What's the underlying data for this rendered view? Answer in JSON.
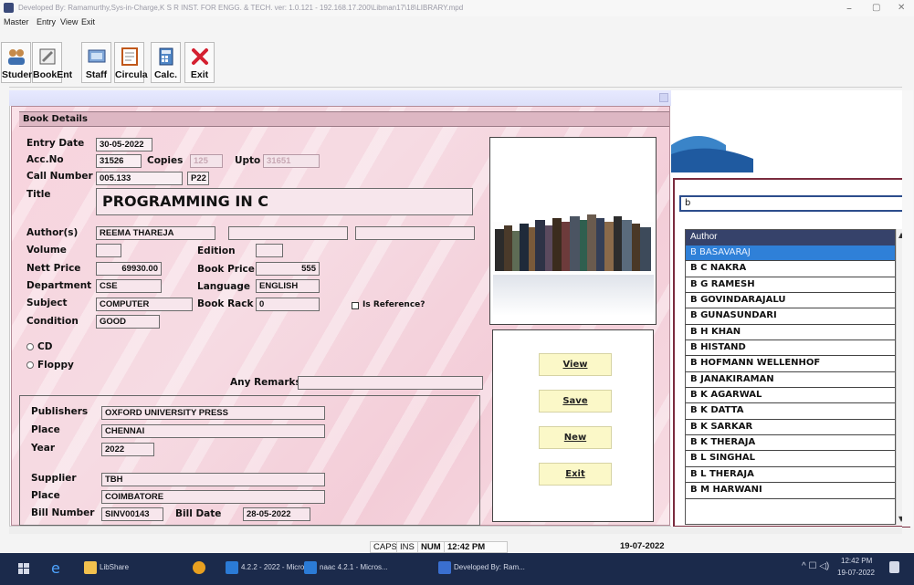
{
  "window": {
    "title": "Developed By: Ramamurthy,Sys-in-Charge,K S R INST. FOR ENGG. & TECH. ver: 1.0.121 - 192.168.17.200\\Libman17\\18\\LIBRARY.mpd",
    "minimize": "–",
    "restore": "▢",
    "close": "✕"
  },
  "menu": [
    "Master",
    "Entry",
    "View",
    "Exit"
  ],
  "toolbar": [
    {
      "label": "Student",
      "icon": "students-icon"
    },
    {
      "label": "BookEnt",
      "icon": "book-entry-icon"
    },
    {
      "label": "Staff",
      "icon": "staff-icon"
    },
    {
      "label": "Circula",
      "icon": "circulation-icon"
    },
    {
      "label": "Calc.",
      "icon": "calculator-icon"
    },
    {
      "label": "Exit",
      "icon": "exit-icon"
    }
  ],
  "form": {
    "header": "Book Details",
    "labels": {
      "entry_date": "Entry Date",
      "acc_no": "Acc.No",
      "copies": "Copies",
      "upto": "Upto",
      "call_number": "Call Number",
      "title": "Title",
      "authors": "Author(s)",
      "volume": "Volume",
      "edition": "Edition",
      "nett_price": "Nett Price",
      "book_price": "Book Price",
      "department": "Department",
      "language": "Language",
      "subject": "Subject",
      "book_rack": "Book Rack",
      "is_reference": "Is Reference?",
      "condition": "Condition",
      "cd": "CD",
      "floppy": "Floppy",
      "any_remarks": "Any Remarks",
      "publishers": "Publishers",
      "pub_place": "Place",
      "year": "Year",
      "supplier": "Supplier",
      "sup_place": "Place",
      "bill_number": "Bill Number",
      "bill_date": "Bill Date"
    },
    "values": {
      "entry_date": "30-05-2022",
      "acc_no": "31526",
      "copies": "125",
      "upto": "31651",
      "call_number": "005.133",
      "call_suffix": "P22",
      "title": "PROGRAMMING IN C",
      "author1": "REEMA THAREJA",
      "author2": "",
      "author3": "",
      "volume": "",
      "edition": "",
      "nett_price": "69930.00",
      "book_price": "555",
      "department": "CSE",
      "language": "ENGLISH",
      "subject": "COMPUTER",
      "book_rack": "0",
      "condition": "GOOD",
      "remarks": "",
      "publishers": "OXFORD UNIVERSITY PRESS",
      "pub_place": "CHENNAI",
      "year": "2022",
      "supplier": "TBH",
      "sup_place": "COIMBATORE",
      "bill_number": "SINV00143",
      "bill_date": "28-05-2022"
    },
    "buttons": {
      "view": "View",
      "save": "Save",
      "new": "New",
      "exit": "Exit"
    }
  },
  "author_search": {
    "query": "b",
    "column_header": "Author",
    "items": [
      "B BASAVARAJ",
      "B C NAKRA",
      "B G RAMESH",
      "B GOVINDARAJALU",
      "B GUNASUNDARI",
      "B H KHAN",
      "B HISTAND",
      "B HOFMANN WELLENHOF",
      "B JANAKIRAMAN",
      "B K AGARWAL",
      "B K DATTA",
      "B K SARKAR",
      "B K THERAJA",
      "B L SINGHAL",
      "B L THERAJA",
      "B M HARWANI"
    ],
    "selected_index": 0
  },
  "statusbar": {
    "caps": "CAPS",
    "ins": "INS",
    "num": "NUM",
    "time": "12:42 PM",
    "date": "19-07-2022"
  },
  "taskbar": {
    "items": [
      "LibShare",
      "4.2.2 - 2022 - Micro...",
      "naac 4.2.1 - Micros...",
      "Developed By: Ram..."
    ],
    "clock_time": "12:42 PM",
    "clock_date": "19-07-2022"
  }
}
